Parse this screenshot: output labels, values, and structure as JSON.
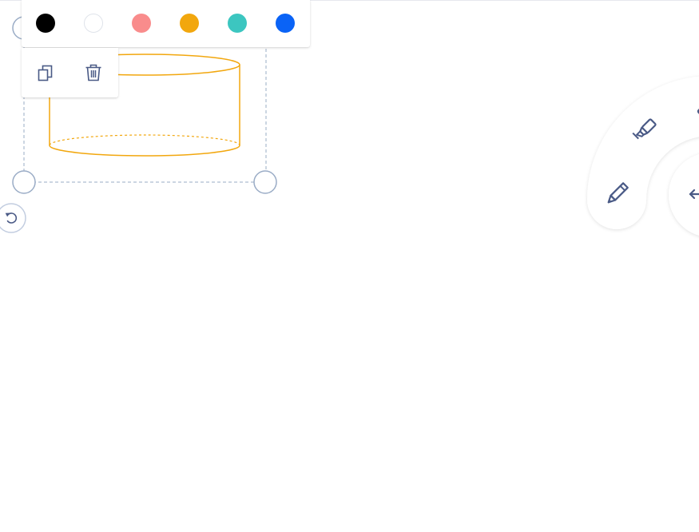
{
  "palette": {
    "swatches": [
      {
        "name": "black",
        "color": "#000000"
      },
      {
        "name": "white",
        "color": "#ffffff"
      },
      {
        "name": "salmon",
        "color": "#f98c8c"
      },
      {
        "name": "orange",
        "color": "#f2a70e"
      },
      {
        "name": "teal",
        "color": "#3cc6c0"
      },
      {
        "name": "blue",
        "color": "#0a63f6"
      }
    ]
  },
  "actions": {
    "duplicate": {
      "icon": "copy-icon"
    },
    "delete": {
      "icon": "trash-icon"
    }
  },
  "shape": {
    "type": "cylinder",
    "stroke_color": "#f2a70e",
    "selection_color": "#9aacc6"
  },
  "radial_menu": {
    "tools": [
      {
        "name": "pen",
        "icon": "pencil-icon"
      },
      {
        "name": "highlighter",
        "icon": "highlighter-icon"
      },
      {
        "name": "eraser",
        "icon": "eraser-icon"
      },
      {
        "name": "back",
        "icon": "arrow-left-icon"
      }
    ],
    "icon_color": "#4a5a86"
  }
}
